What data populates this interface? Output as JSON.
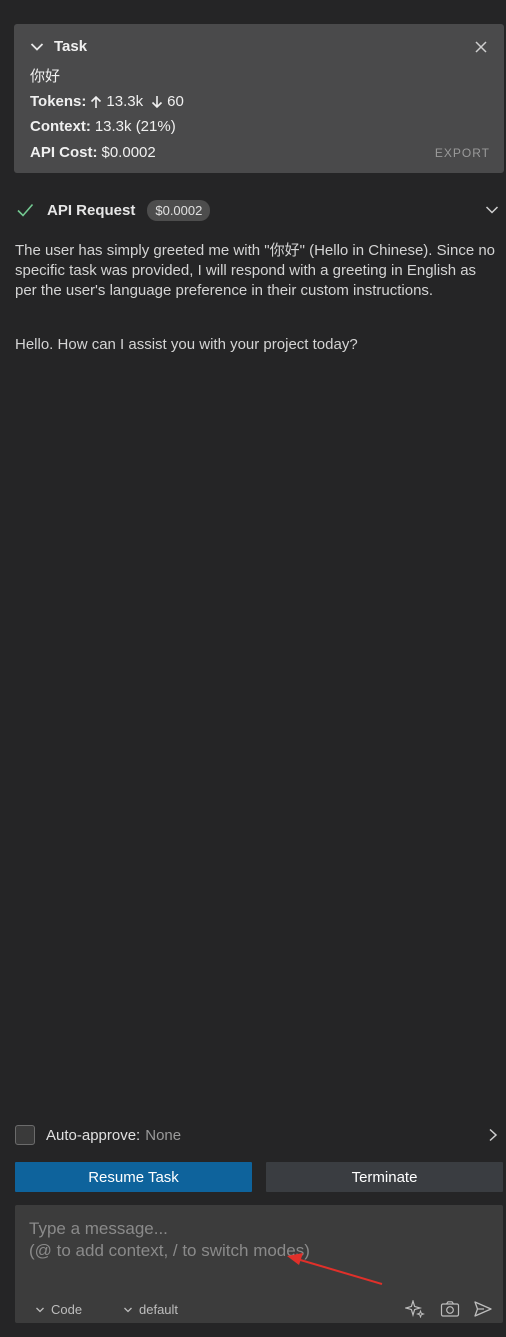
{
  "task": {
    "header_label": "Task",
    "message": "你好",
    "tokens_label": "Tokens:",
    "tokens_up": "13.3k",
    "tokens_down": "60",
    "context_label": "Context:",
    "context_value": "13.3k (21%)",
    "cost_label": "API Cost:",
    "cost_value": "$0.0002",
    "export_label": "EXPORT"
  },
  "api_request": {
    "title": "API Request",
    "cost_badge": "$0.0002",
    "status": "success"
  },
  "messages": [
    "The user has simply greeted me with \"你好\" (Hello in Chinese). Since no specific task was provided, I will respond with a greeting in English as per the user's language preference in their custom instructions.",
    "Hello. How can I assist you with your project today?"
  ],
  "auto_approve": {
    "label": "Auto-approve:",
    "value": "None",
    "checked": false
  },
  "buttons": {
    "resume": "Resume Task",
    "terminate": "Terminate"
  },
  "input": {
    "placeholder": "Type a message...\n(@ to add context, / to switch modes)",
    "mode": "Code",
    "profile": "default"
  },
  "colors": {
    "background": "#252526",
    "card": "#4a4a4b",
    "primary_button": "#0e639c",
    "secondary_button": "#3a3d41",
    "success": "#73c991",
    "annotation_arrow": "#e0302a"
  },
  "icons": {
    "task_chevron": "chevron-down-icon",
    "task_close": "close-icon",
    "check": "check-icon",
    "api_expand": "chevron-down-icon",
    "auto_expand": "chevron-right-icon",
    "sparkle": "sparkle-icon",
    "camera": "camera-icon",
    "send": "send-icon"
  }
}
